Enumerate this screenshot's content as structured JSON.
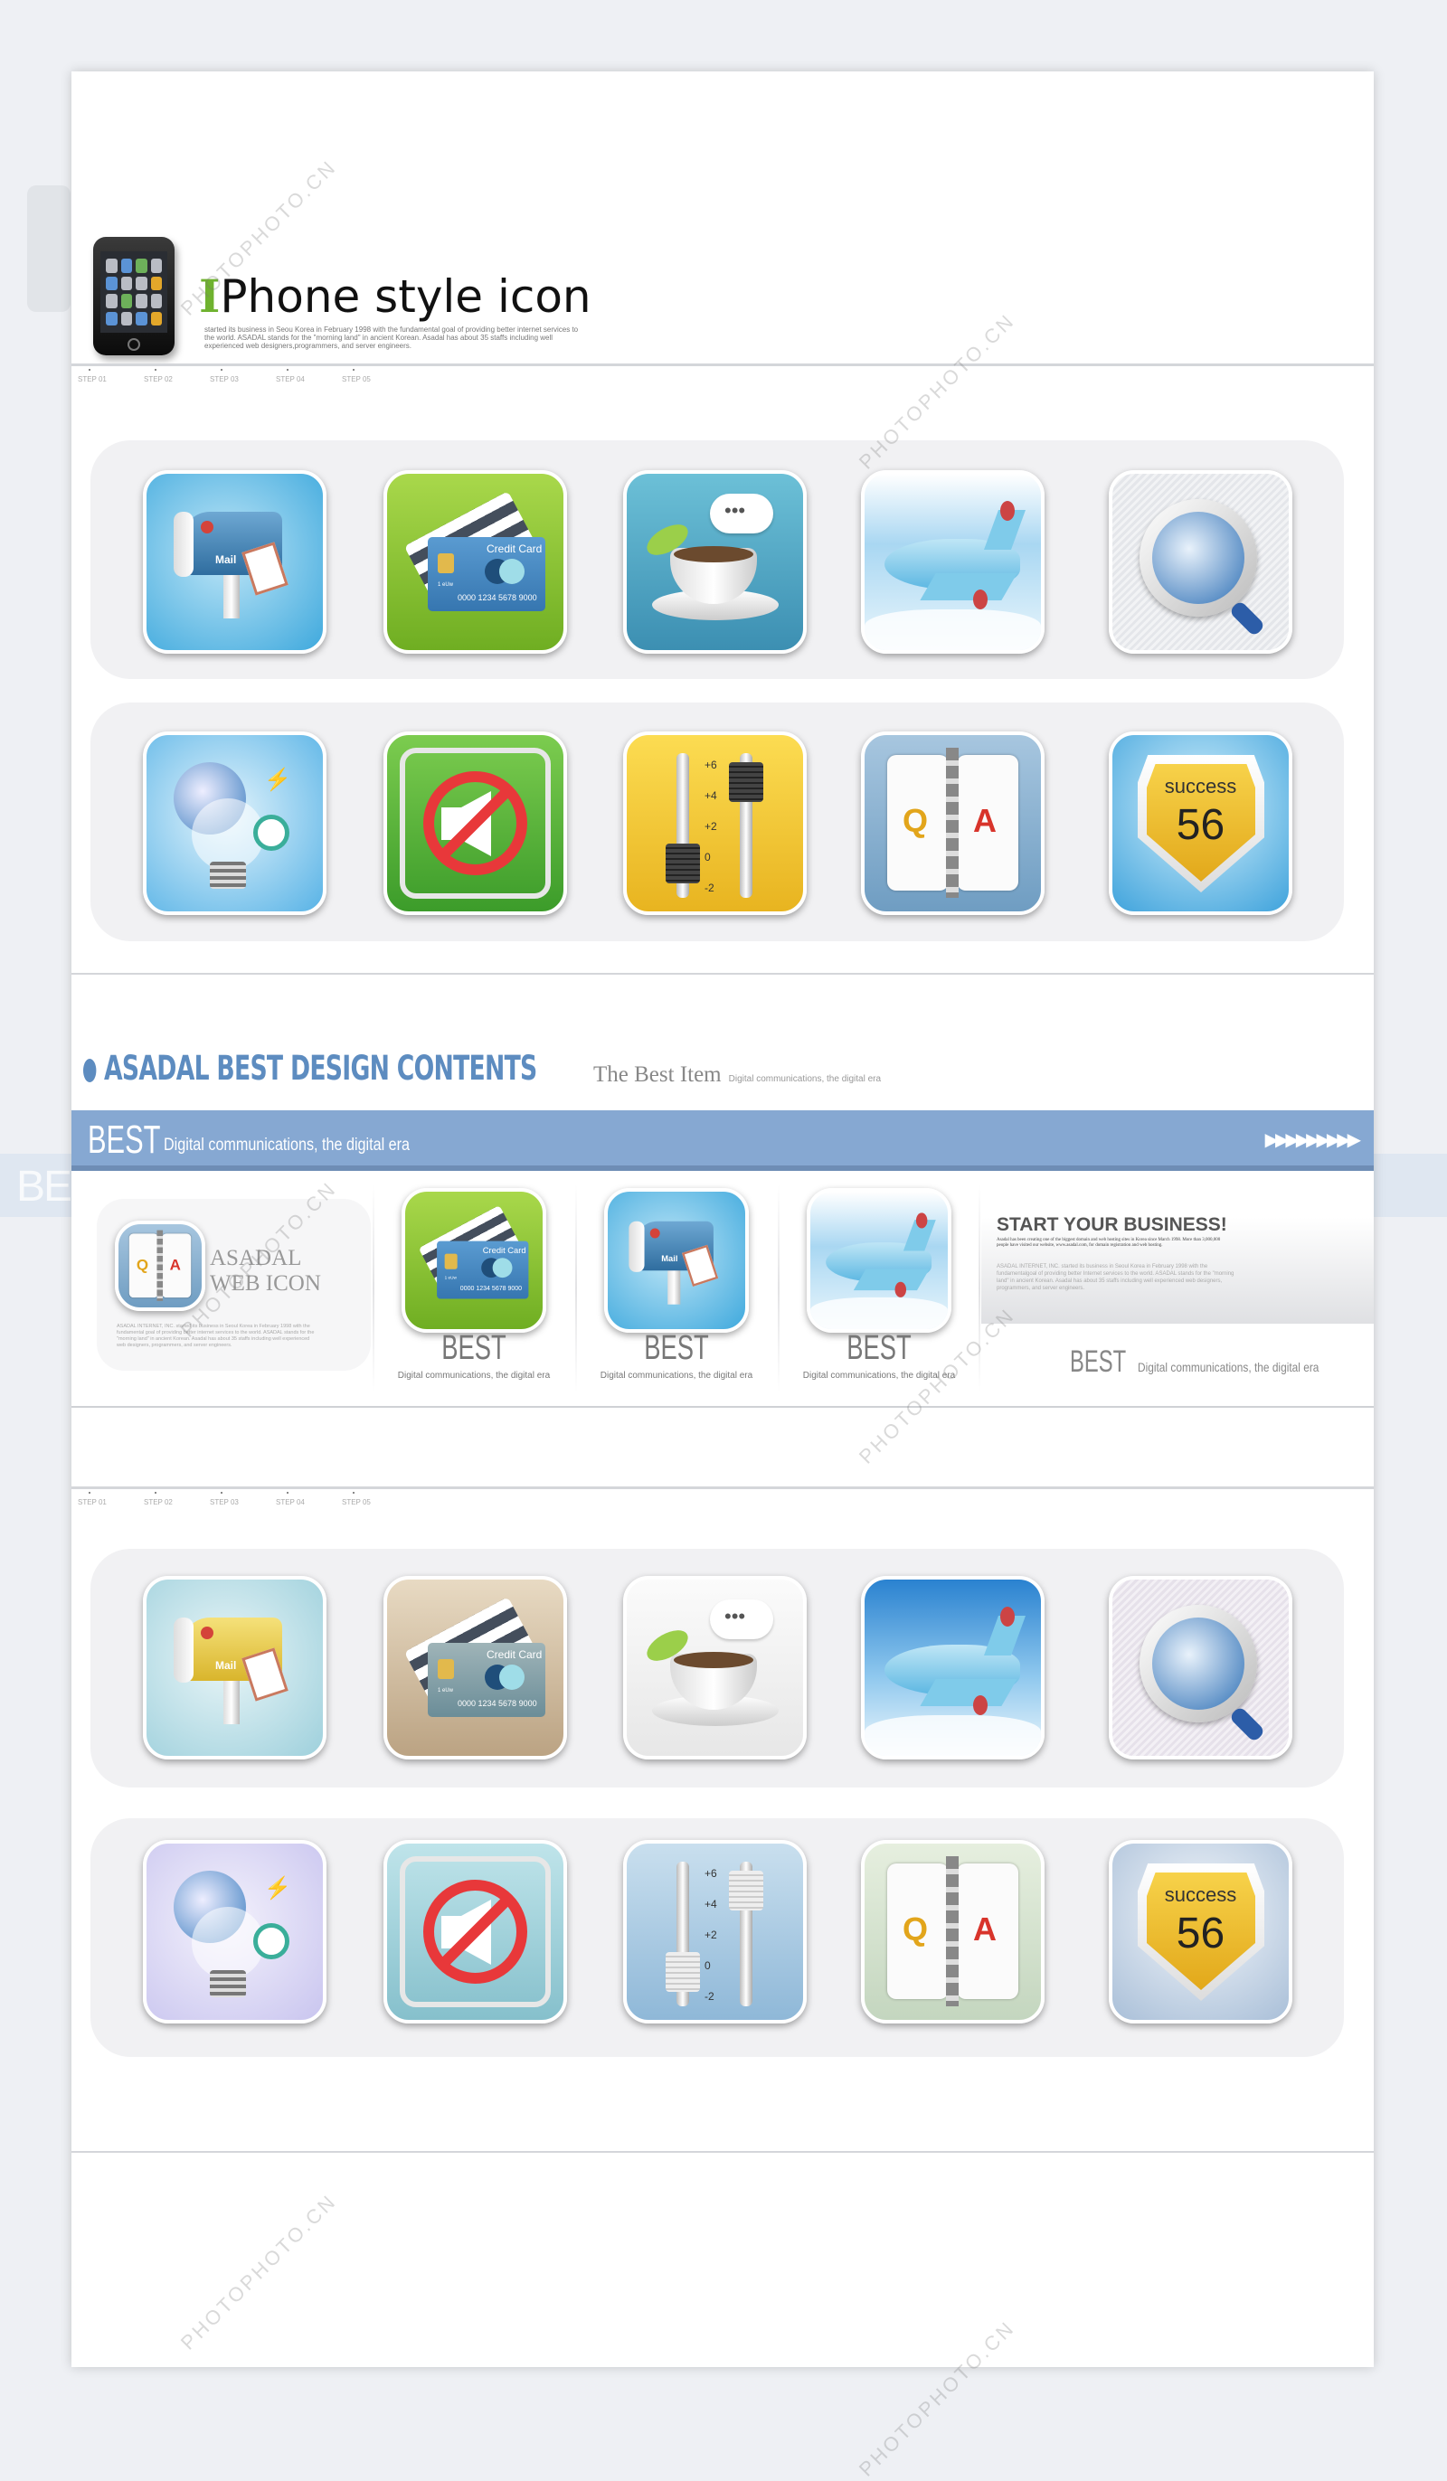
{
  "header": {
    "title_cap": "I",
    "title_rest": "Phone style icon",
    "blurb": "started its business in Seou Korea in February 1998 with the fundamental goal of providing better internet services to the world. ASADAL stands for the \"morning land\" in ancient Korean. Asadal has about 35 staffs including well experienced web designers,programmers, and server engineers.",
    "steps": [
      "STEP 01",
      "STEP 02",
      "STEP 03",
      "STEP 04",
      "STEP 05"
    ]
  },
  "icon_text": {
    "mail": "Mail",
    "card_title": "Credit Card",
    "card_number": "0000 1234 5678 9000",
    "card_small": "1 eUw",
    "bubble": "•••",
    "eq_labels": [
      "+6",
      "+4",
      "+2",
      "0",
      "-2"
    ],
    "q": "Q",
    "a": "A",
    "success": "success",
    "success_num": "56"
  },
  "icon_sets": [
    {
      "row": "colored",
      "icons": [
        "mail",
        "credit-card",
        "coffee",
        "airplane",
        "globe-search",
        "lightbulb-globe",
        "mute",
        "equalizer",
        "qa-book",
        "success-badge"
      ]
    },
    {
      "row": "pastel",
      "icons": [
        "mail",
        "credit-card",
        "coffee",
        "airplane",
        "globe-search",
        "lightbulb-globe",
        "mute",
        "equalizer",
        "qa-book",
        "success-badge"
      ]
    }
  ],
  "colors": {
    "accent_blue": "#86a8d2",
    "heading_blue": "#5d8cc0",
    "title_green": "#6fb22f"
  },
  "section": {
    "heading": "ASADAL BEST DESIGN CONTENTS",
    "best_item": "The Best Item",
    "best_item_sub": "Digital communications, the digital era",
    "bar_big": "BEST",
    "bar_sub": "Digital communications, the digital era",
    "bar_arrows": "▶▶▶▶▶▶▶▶▶",
    "card_title_1": "ASADAL",
    "card_title_2": "WEB ICON",
    "card_text": "ASADAL INTERNET, INC. started its business in Seoul Korea in February 1998 with the fundamental goal of providing better internet services to the world. ASADAL stands for the \"morning land\" in ancient Korean. Asadal has about 35 staffs including well experienced web designers, programmers, and server engineers.",
    "best_items": [
      {
        "icon": "credit-card",
        "label": "BEST",
        "caption": "Digital communications, the digital era"
      },
      {
        "icon": "mail",
        "label": "BEST",
        "caption": "Digital communications, the digital era"
      },
      {
        "icon": "airplane",
        "label": "BEST",
        "caption": "Digital communications, the digital era"
      }
    ],
    "start_title": "START YOUR BUSINESS!",
    "start_text_1": "Asadal has been creating one of the biggest domain and web hosting sites in Korea since March 1998. More than 3,000,000 people have visited our website, www.asadal.com, for domain registration and web hosting.",
    "start_text_2": "ASADAL INTERNET, INC. started its business in Seoul Korea in February 1998 with the fundamentalgoal of providing better Internet services to the world. ASADAL stands for the \"morning land\" in ancient Korean. Asadal has about 35 staffs including well experienced web designers, programmers, and server engineers.",
    "start_big": "BEST",
    "start_sub": "Digital communications, the digital era"
  },
  "watermark": "PHOTOPHOTO.CN"
}
